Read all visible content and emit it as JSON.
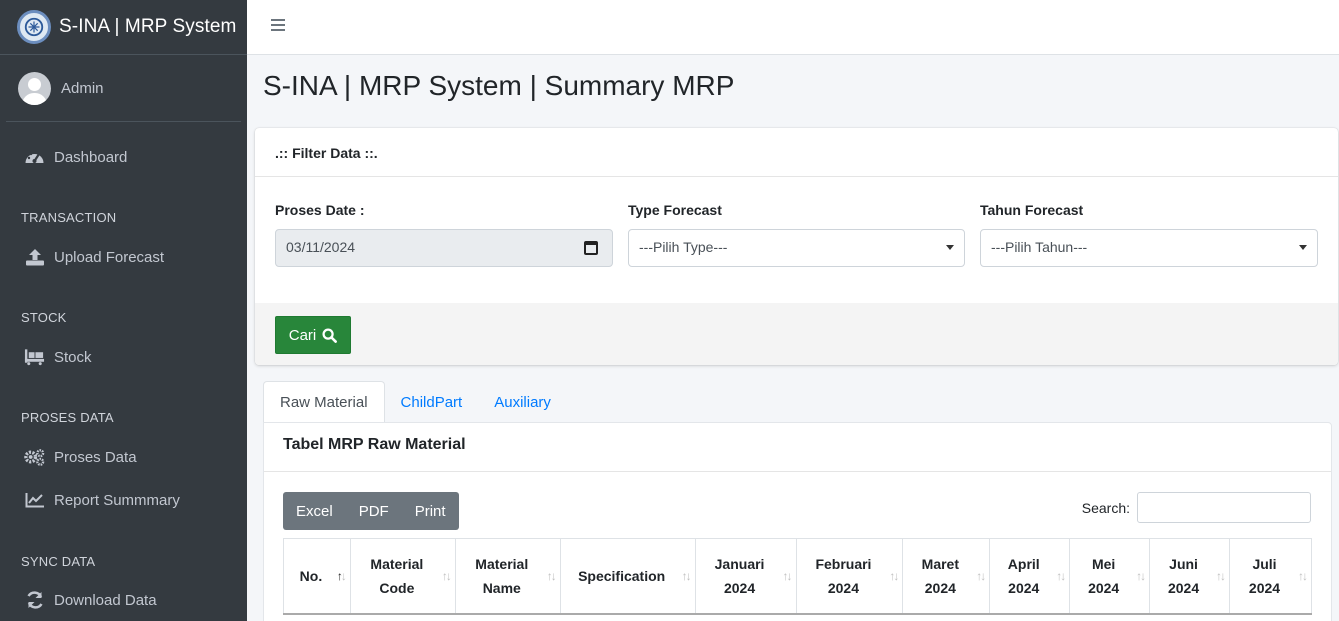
{
  "app": {
    "brand": "S-INA | MRP System",
    "colors": {
      "sidebar": "#343a40",
      "accent": "#007bff",
      "success": "#28863a"
    }
  },
  "user": {
    "name": "Admin"
  },
  "sidebar": {
    "dashboard": "Dashboard",
    "sections": [
      {
        "header": "TRANSACTION",
        "items": [
          {
            "label": "Upload Forecast",
            "icon": "upload-icon"
          }
        ]
      },
      {
        "header": "STOCK",
        "items": [
          {
            "label": "Stock",
            "icon": "pallet-icon"
          }
        ]
      },
      {
        "header": "PROSES DATA",
        "items": [
          {
            "label": "Proses Data",
            "icon": "gears-icon"
          },
          {
            "label": "Report Summmary",
            "icon": "line-chart-icon"
          }
        ]
      },
      {
        "header": "SYNC DATA",
        "items": [
          {
            "label": "Download Data",
            "icon": "sync-icon"
          }
        ]
      }
    ]
  },
  "page": {
    "title": "S-INA | MRP System | Summary MRP"
  },
  "filter": {
    "title": ".:: Filter Data ::.",
    "proses_date_label": "Proses Date :",
    "proses_date_value": "03/11/2024",
    "type_label": "Type Forecast",
    "type_value": "---Pilih Type---",
    "tahun_label": "Tahun Forecast",
    "tahun_value": "---Pilih Tahun---",
    "search_button": "Cari"
  },
  "tabs": [
    {
      "label": "Raw Material",
      "active": true
    },
    {
      "label": "ChildPart",
      "active": false
    },
    {
      "label": "Auxiliary",
      "active": false
    }
  ],
  "table_card": {
    "title": "Tabel MRP Raw Material",
    "buttons": {
      "excel": "Excel",
      "pdf": "PDF",
      "print": "Print"
    },
    "search_label": "Search:",
    "columns": [
      {
        "line1": "No.",
        "line2": ""
      },
      {
        "line1": "Material",
        "line2": "Code"
      },
      {
        "line1": "Material",
        "line2": "Name"
      },
      {
        "line1": "Specification",
        "line2": ""
      },
      {
        "line1": "Januari",
        "line2": "2024"
      },
      {
        "line1": "Februari",
        "line2": "2024"
      },
      {
        "line1": "Maret",
        "line2": "2024"
      },
      {
        "line1": "April",
        "line2": "2024"
      },
      {
        "line1": "Mei",
        "line2": "2024"
      },
      {
        "line1": "Juni",
        "line2": "2024"
      },
      {
        "line1": "Juli",
        "line2": "2024"
      }
    ]
  }
}
